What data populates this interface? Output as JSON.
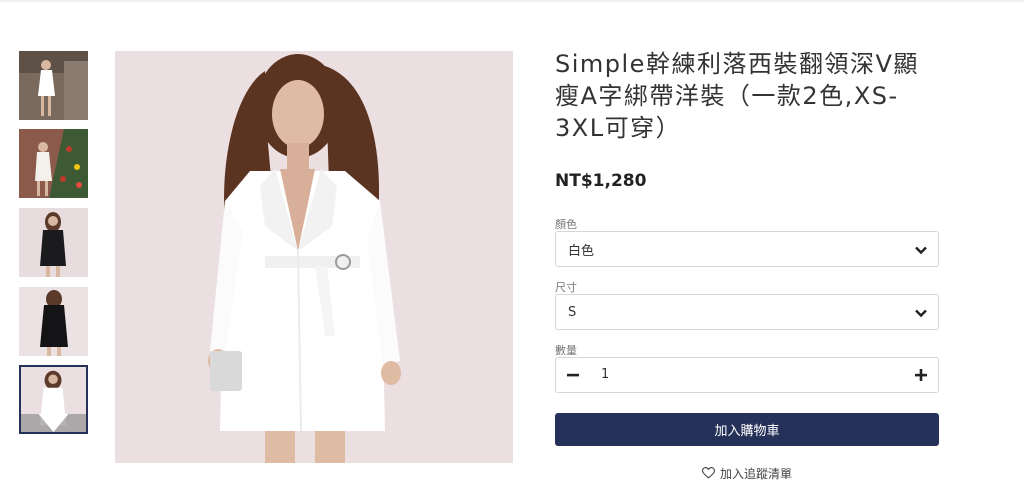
{
  "product": {
    "title": "Simple幹練利落西裝翻領深V顯瘦A字綁帶洋裝（一款2色,XS-3XL可穿）",
    "price": "NT$1,280"
  },
  "options": {
    "color": {
      "label": "顏色",
      "selected": "白色"
    },
    "size": {
      "label": "尺寸",
      "selected": "S"
    },
    "quantity": {
      "label": "數量",
      "value": "1"
    }
  },
  "actions": {
    "add_to_cart": "加入購物車",
    "wishlist": "加入追蹤清單"
  },
  "icons": {
    "select": "chevron-down-icon",
    "minus": "minus-icon",
    "plus": "plus-icon",
    "wishlist": "heart-icon",
    "thumb_nav": "triangle-down-icon"
  },
  "colors": {
    "primary": "#263159",
    "border": "#d4d6da"
  }
}
